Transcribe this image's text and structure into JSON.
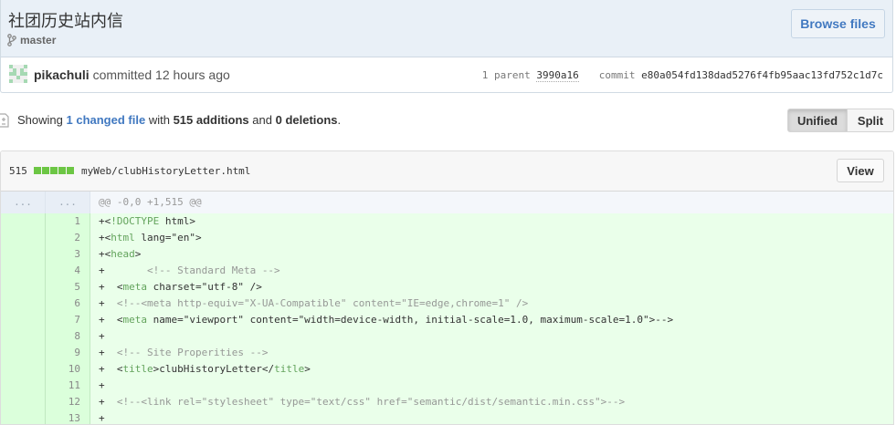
{
  "commit": {
    "title": "社团历史站内信",
    "branch": "master",
    "browse_files_label": "Browse files",
    "author": "pikachuli",
    "committed_text": "committed 12 hours ago",
    "parent_label": "1 parent",
    "parent_sha": "3990a16",
    "commit_label": "commit",
    "commit_sha": "e80a054fd138dad5276f4fb95aac13fd752c1d7c"
  },
  "toc": {
    "showing": "Showing",
    "changed_files": "1 changed file",
    "with": "with",
    "additions": "515 additions",
    "and": "and",
    "deletions": "0 deletions",
    "period": "."
  },
  "view_toggle": {
    "unified_label": "Unified",
    "split_label": "Split",
    "selected": "Unified"
  },
  "file": {
    "additions_count": "515",
    "diffstat_blocks": 5,
    "path": "myWeb/clubHistoryLetter.html",
    "view_label": "View",
    "hunk_old": "...",
    "hunk_new": "...",
    "hunk_header": "@@ -0,0 +1,515 @@",
    "lines": [
      {
        "n": "1",
        "text": "+<!DOCTYPE html>"
      },
      {
        "n": "2",
        "text": "+<html lang=\"en\">"
      },
      {
        "n": "3",
        "text": "+<head>"
      },
      {
        "n": "4",
        "text": "+       <!-- Standard Meta -->"
      },
      {
        "n": "5",
        "text": "+  <meta charset=\"utf-8\" />"
      },
      {
        "n": "6",
        "text": "+  <!--<meta http-equiv=\"X-UA-Compatible\" content=\"IE=edge,chrome=1\" />"
      },
      {
        "n": "7",
        "text": "+  <meta name=\"viewport\" content=\"width=device-width, initial-scale=1.0, maximum-scale=1.0\">-->"
      },
      {
        "n": "8",
        "text": "+"
      },
      {
        "n": "9",
        "text": "+  <!-- Site Properities -->"
      },
      {
        "n": "10",
        "text": "+  <title>clubHistoryLetter</title>"
      },
      {
        "n": "11",
        "text": "+"
      },
      {
        "n": "12",
        "text": "+  <!--<link rel=\"stylesheet\" type=\"text/css\" href=\"semantic/dist/semantic.min.css\">-->"
      },
      {
        "n": "13",
        "text": "+"
      }
    ]
  },
  "colors": {
    "link": "#4078c0",
    "addition_bg": "#eaffea",
    "addition_gutter": "#dbffdb",
    "diffstat_green": "#6cc644",
    "header_bg": "#e9f0f7"
  }
}
